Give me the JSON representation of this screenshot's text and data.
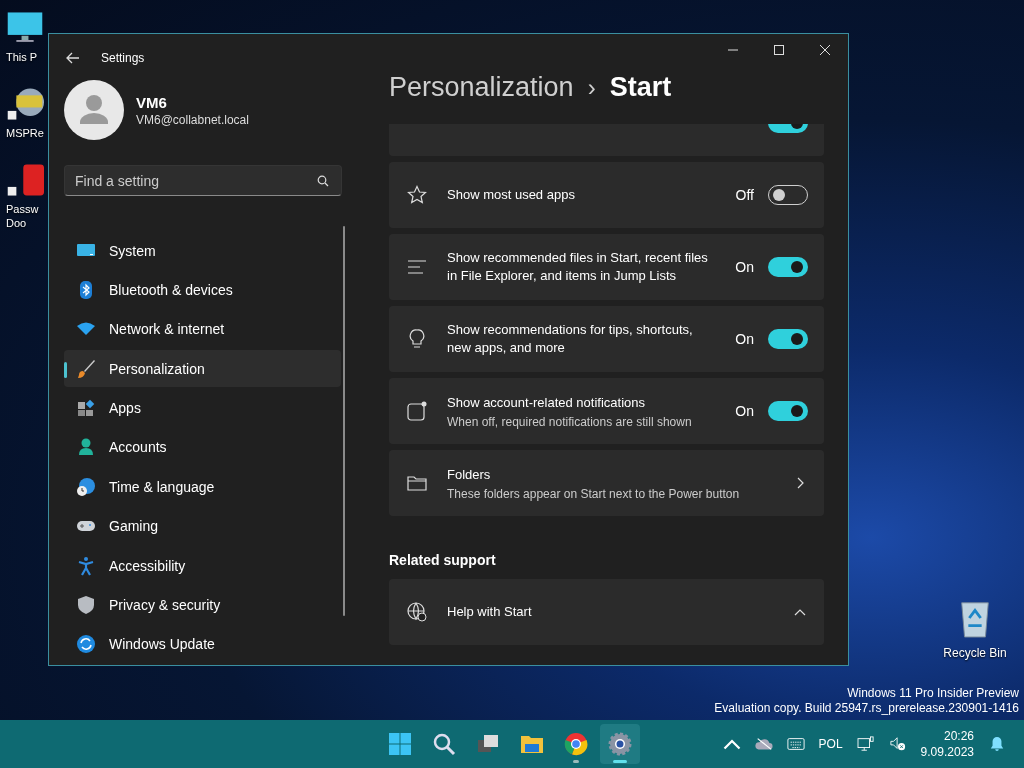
{
  "desktop": {
    "icons": [
      {
        "kind": "monitor",
        "lines": [
          "This P"
        ]
      },
      {
        "kind": "app-badge",
        "lines": [
          "MSPRe"
        ]
      },
      {
        "kind": "app-red",
        "lines": [
          "Passw",
          "Doo"
        ]
      }
    ],
    "recycle_bin": {
      "label": "Recycle Bin"
    },
    "watermark": [
      "Windows 11 Pro Insider Preview",
      "Evaluation copy. Build 25947.rs_prerelease.230901-1416"
    ]
  },
  "window": {
    "title": "Settings",
    "user": {
      "name": "VM6",
      "email": "VM6@collabnet.local"
    },
    "search": {
      "placeholder": "Find a setting"
    },
    "nav": [
      {
        "label": "System",
        "selected": false
      },
      {
        "label": "Bluetooth & devices",
        "selected": false
      },
      {
        "label": "Network & internet",
        "selected": false
      },
      {
        "label": "Personalization",
        "selected": true
      },
      {
        "label": "Apps",
        "selected": false
      },
      {
        "label": "Accounts",
        "selected": false
      },
      {
        "label": "Time & language",
        "selected": false
      },
      {
        "label": "Gaming",
        "selected": false
      },
      {
        "label": "Accessibility",
        "selected": false
      },
      {
        "label": "Privacy & security",
        "selected": false
      },
      {
        "label": "Windows Update",
        "selected": false
      }
    ],
    "breadcrumb": {
      "parent": "Personalization",
      "separator": "›",
      "current": "Start"
    },
    "cut_off_card": {
      "on": true
    },
    "settings": [
      {
        "kind": "toggle",
        "title": "Show most used apps",
        "state": "Off",
        "on": false
      },
      {
        "kind": "toggle",
        "title": "Show recommended files in Start, recent files in File Explorer, and items in Jump Lists",
        "state": "On",
        "on": true
      },
      {
        "kind": "toggle",
        "title": "Show recommendations for tips, shortcuts, new apps, and more",
        "state": "On",
        "on": true
      },
      {
        "kind": "toggle",
        "title": "Show account-related notifications",
        "subtitle": "When off, required notifications are still shown",
        "state": "On",
        "on": true
      },
      {
        "kind": "link",
        "title": "Folders",
        "subtitle": "These folders appear on Start next to the Power button"
      }
    ],
    "related_support": {
      "heading": "Related support",
      "items": [
        {
          "title": "Help with Start",
          "expanded": true
        }
      ]
    }
  },
  "taskbar": {
    "apps": [
      {
        "kind": "start",
        "running": false,
        "active": false
      },
      {
        "kind": "search",
        "running": false,
        "active": false
      },
      {
        "kind": "taskview",
        "running": false,
        "active": false
      },
      {
        "kind": "explorer",
        "running": false,
        "active": false
      },
      {
        "kind": "chrome",
        "running": true,
        "active": false
      },
      {
        "kind": "settings",
        "running": true,
        "active": true
      }
    ],
    "language": "POL",
    "time": "20:26",
    "date": "9.09.2023"
  }
}
